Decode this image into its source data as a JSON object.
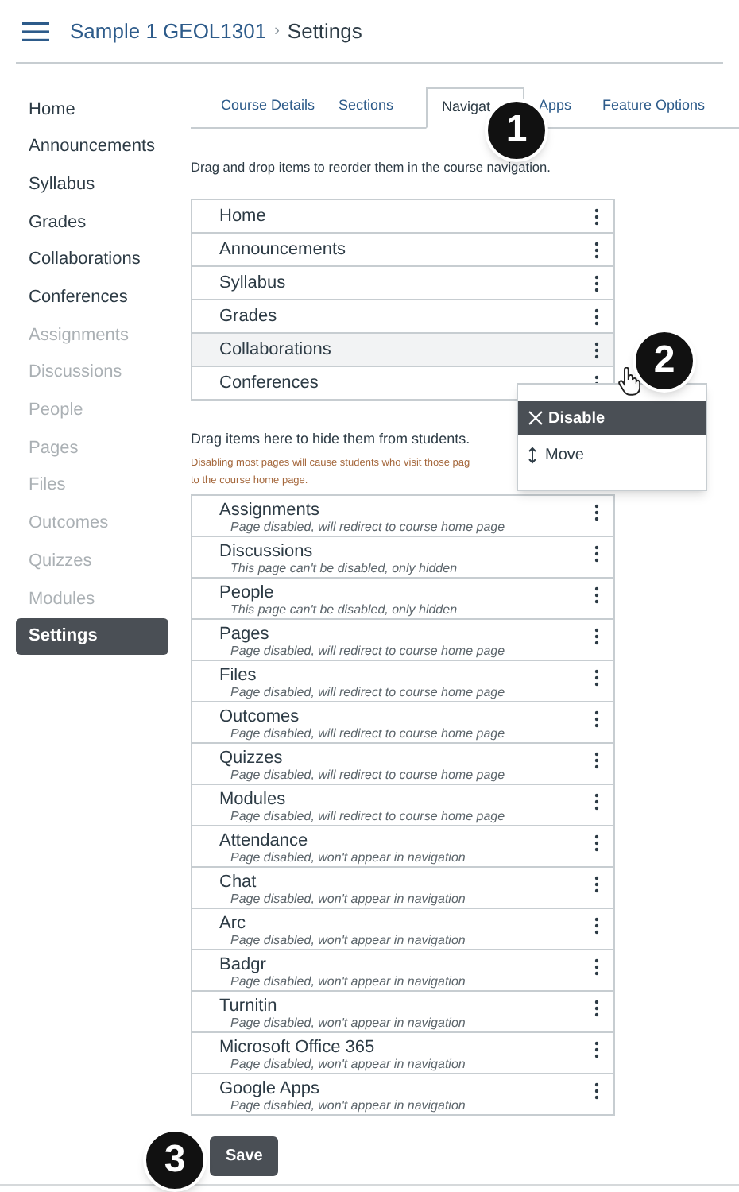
{
  "header": {
    "course": "Sample 1 GEOL1301",
    "separator": "›",
    "page": "Settings"
  },
  "sidebar": {
    "items": [
      {
        "label": "Home",
        "hidden": false,
        "selected": false
      },
      {
        "label": "Announcements",
        "hidden": false,
        "selected": false
      },
      {
        "label": "Syllabus",
        "hidden": false,
        "selected": false
      },
      {
        "label": "Grades",
        "hidden": false,
        "selected": false
      },
      {
        "label": "Collaborations",
        "hidden": false,
        "selected": false
      },
      {
        "label": "Conferences",
        "hidden": false,
        "selected": false
      },
      {
        "label": "Assignments",
        "hidden": true,
        "selected": false
      },
      {
        "label": "Discussions",
        "hidden": true,
        "selected": false
      },
      {
        "label": "People",
        "hidden": true,
        "selected": false
      },
      {
        "label": "Pages",
        "hidden": true,
        "selected": false
      },
      {
        "label": "Files",
        "hidden": true,
        "selected": false
      },
      {
        "label": "Outcomes",
        "hidden": true,
        "selected": false
      },
      {
        "label": "Quizzes",
        "hidden": true,
        "selected": false
      },
      {
        "label": "Modules",
        "hidden": true,
        "selected": false
      },
      {
        "label": "Settings",
        "hidden": false,
        "selected": true
      }
    ]
  },
  "tabs": [
    {
      "label": "Course Details",
      "selected": false
    },
    {
      "label": "Sections",
      "selected": false
    },
    {
      "label": "Navigat",
      "selected": true
    },
    {
      "label": "Apps",
      "selected": false
    },
    {
      "label": "Feature Options",
      "selected": false
    }
  ],
  "instructions": "Drag and drop items to reorder them in the course navigation.",
  "enabled_items": [
    {
      "label": "Home",
      "highlighted": false
    },
    {
      "label": "Announcements",
      "highlighted": false
    },
    {
      "label": "Syllabus",
      "highlighted": false
    },
    {
      "label": "Grades",
      "highlighted": false
    },
    {
      "label": "Collaborations",
      "highlighted": true
    },
    {
      "label": "Conferences",
      "highlighted": false
    }
  ],
  "hidden_heading": "Drag items here to hide them from students.",
  "hidden_note_lines": [
    "Disabling most pages will cause students who visit those pag",
    "to the course home page."
  ],
  "disabled_items": [
    {
      "label": "Assignments",
      "note": "Page disabled, will redirect to course home page"
    },
    {
      "label": "Discussions",
      "note": "This page can't be disabled, only hidden"
    },
    {
      "label": "People",
      "note": "This page can't be disabled, only hidden"
    },
    {
      "label": "Pages",
      "note": "Page disabled, will redirect to course home page"
    },
    {
      "label": "Files",
      "note": "Page disabled, will redirect to course home page"
    },
    {
      "label": "Outcomes",
      "note": "Page disabled, will redirect to course home page"
    },
    {
      "label": "Quizzes",
      "note": "Page disabled, will redirect to course home page"
    },
    {
      "label": "Modules",
      "note": "Page disabled, will redirect to course home page"
    },
    {
      "label": "Attendance",
      "note": "Page disabled, won't appear in navigation"
    },
    {
      "label": "Chat",
      "note": "Page disabled, won't appear in navigation"
    },
    {
      "label": "Arc",
      "note": "Page disabled, won't appear in navigation"
    },
    {
      "label": "Badgr",
      "note": "Page disabled, won't appear in navigation"
    },
    {
      "label": "Turnitin",
      "note": "Page disabled, won't appear in navigation"
    },
    {
      "label": "Microsoft Office 365",
      "note": "Page disabled, won't appear in navigation"
    },
    {
      "label": "Google Apps",
      "note": "Page disabled, won't appear in navigation"
    }
  ],
  "menu": {
    "items": [
      {
        "kind": "disable",
        "label": "Disable",
        "highlighted": true
      },
      {
        "kind": "move",
        "label": "Move",
        "highlighted": false
      }
    ]
  },
  "save_button": "Save",
  "callouts": [
    "1",
    "2",
    "3"
  ]
}
